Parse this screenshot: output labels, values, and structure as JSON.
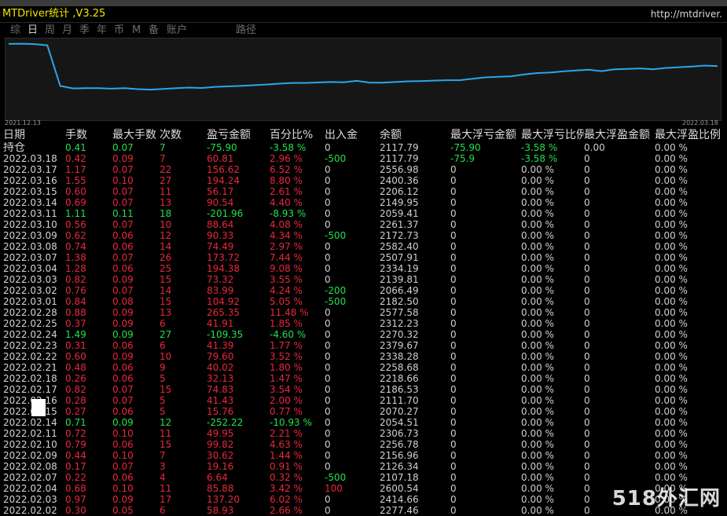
{
  "app": {
    "title": "MTDriver统计 ,V3.25",
    "url": "http://mtdriver."
  },
  "tabs": [
    {
      "label": "综",
      "active": false
    },
    {
      "label": "日",
      "active": true
    },
    {
      "label": "周",
      "active": false
    },
    {
      "label": "月",
      "active": false
    },
    {
      "label": "季",
      "active": false
    },
    {
      "label": "年",
      "active": false
    },
    {
      "label": "币",
      "active": false
    },
    {
      "label": "M",
      "active": false
    },
    {
      "label": "备",
      "active": false
    },
    {
      "label": "账户",
      "active": false
    },
    {
      "label": "路径",
      "active": false
    }
  ],
  "chart": {
    "start_date": "2021.12.13",
    "end_date": "2022.03.18",
    "line_color": "#2aa7e8",
    "y_range": [
      2000,
      3600
    ],
    "balance_series": [
      3550,
      3555,
      3548,
      3520,
      2640,
      2585,
      2590,
      2590,
      2580,
      2590,
      2570,
      2560,
      2575,
      2590,
      2605,
      2595,
      2620,
      2630,
      2640,
      2655,
      2670,
      2690,
      2705,
      2705,
      2715,
      2725,
      2720,
      2750,
      2710,
      2710,
      2725,
      2740,
      2745,
      2755,
      2765,
      2765,
      2795,
      2825,
      2838,
      2850,
      2890,
      2920,
      2930,
      2955,
      2975,
      2990,
      2960,
      3000,
      3010,
      3020,
      3000,
      3030,
      3045,
      3060,
      3080,
      3070
    ]
  },
  "columns": [
    "日期",
    "手数",
    "最大手数",
    "次数",
    "盈亏金额",
    "百分比%",
    "出入金",
    "余额",
    "最大浮亏金额",
    "最大浮亏比例",
    "最大浮盈金额",
    "最大浮盈比例"
  ],
  "position_row": {
    "date": "持仓",
    "lots": "0.41",
    "maxlots": "0.07",
    "count": "7",
    "pnl": "-75.90",
    "pct": "-3.58 %",
    "io": "0",
    "bal": "2117.79",
    "mfl": "-75.90",
    "mflp": "-3.58 %",
    "mfp": "0.00",
    "mfpp": "0.00 %",
    "color": "g"
  },
  "rows": [
    {
      "date": "2022.03.18",
      "lots": "0.42",
      "maxlots": "0.09",
      "count": "7",
      "pnl": "60.81",
      "pct": "2.96 %",
      "io": "-500",
      "bal": "2117.79",
      "mfl": "-75.9",
      "mflp": "-3.58 %",
      "mfp": "0",
      "mfpp": "0.00 %",
      "color": "r"
    },
    {
      "date": "2022.03.17",
      "lots": "1.17",
      "maxlots": "0.07",
      "count": "22",
      "pnl": "156.62",
      "pct": "6.52 %",
      "io": "0",
      "bal": "2556.98",
      "mfl": "0",
      "mflp": "0.00 %",
      "mfp": "0",
      "mfpp": "0.00 %",
      "color": "r"
    },
    {
      "date": "2022.03.16",
      "lots": "1.55",
      "maxlots": "0.10",
      "count": "27",
      "pnl": "194.24",
      "pct": "8.80 %",
      "io": "0",
      "bal": "2400.36",
      "mfl": "0",
      "mflp": "0.00 %",
      "mfp": "0",
      "mfpp": "0.00 %",
      "color": "r"
    },
    {
      "date": "2022.03.15",
      "lots": "0.60",
      "maxlots": "0.07",
      "count": "11",
      "pnl": "56.17",
      "pct": "2.61 %",
      "io": "0",
      "bal": "2206.12",
      "mfl": "0",
      "mflp": "0.00 %",
      "mfp": "0",
      "mfpp": "0.00 %",
      "color": "r"
    },
    {
      "date": "2022.03.14",
      "lots": "0.69",
      "maxlots": "0.07",
      "count": "13",
      "pnl": "90.54",
      "pct": "4.40 %",
      "io": "0",
      "bal": "2149.95",
      "mfl": "0",
      "mflp": "0.00 %",
      "mfp": "0",
      "mfpp": "0.00 %",
      "color": "r"
    },
    {
      "date": "2022.03.11",
      "lots": "1.11",
      "maxlots": "0.11",
      "count": "18",
      "pnl": "-201.96",
      "pct": "-8.93 %",
      "io": "0",
      "bal": "2059.41",
      "mfl": "0",
      "mflp": "0.00 %",
      "mfp": "0",
      "mfpp": "0.00 %",
      "color": "g"
    },
    {
      "date": "2022.03.10",
      "lots": "0.56",
      "maxlots": "0.07",
      "count": "10",
      "pnl": "88.64",
      "pct": "4.08 %",
      "io": "0",
      "bal": "2261.37",
      "mfl": "0",
      "mflp": "0.00 %",
      "mfp": "0",
      "mfpp": "0.00 %",
      "color": "r"
    },
    {
      "date": "2022.03.09",
      "lots": "0.62",
      "maxlots": "0.06",
      "count": "12",
      "pnl": "90.33",
      "pct": "4.34 %",
      "io": "-500",
      "bal": "2172.73",
      "mfl": "0",
      "mflp": "0.00 %",
      "mfp": "0",
      "mfpp": "0.00 %",
      "color": "r"
    },
    {
      "date": "2022.03.08",
      "lots": "0.74",
      "maxlots": "0.06",
      "count": "14",
      "pnl": "74.49",
      "pct": "2.97 %",
      "io": "0",
      "bal": "2582.40",
      "mfl": "0",
      "mflp": "0.00 %",
      "mfp": "0",
      "mfpp": "0.00 %",
      "color": "r"
    },
    {
      "date": "2022.03.07",
      "lots": "1.38",
      "maxlots": "0.07",
      "count": "26",
      "pnl": "173.72",
      "pct": "7.44 %",
      "io": "0",
      "bal": "2507.91",
      "mfl": "0",
      "mflp": "0.00 %",
      "mfp": "0",
      "mfpp": "0.00 %",
      "color": "r"
    },
    {
      "date": "2022.03.04",
      "lots": "1.28",
      "maxlots": "0.06",
      "count": "25",
      "pnl": "194.38",
      "pct": "9.08 %",
      "io": "0",
      "bal": "2334.19",
      "mfl": "0",
      "mflp": "0.00 %",
      "mfp": "0",
      "mfpp": "0.00 %",
      "color": "r"
    },
    {
      "date": "2022.03.03",
      "lots": "0.82",
      "maxlots": "0.09",
      "count": "15",
      "pnl": "73.32",
      "pct": "3.55 %",
      "io": "0",
      "bal": "2139.81",
      "mfl": "0",
      "mflp": "0.00 %",
      "mfp": "0",
      "mfpp": "0.00 %",
      "color": "r"
    },
    {
      "date": "2022.03.02",
      "lots": "0.76",
      "maxlots": "0.07",
      "count": "14",
      "pnl": "83.99",
      "pct": "4.24 %",
      "io": "-200",
      "bal": "2066.49",
      "mfl": "0",
      "mflp": "0.00 %",
      "mfp": "0",
      "mfpp": "0.00 %",
      "color": "r"
    },
    {
      "date": "2022.03.01",
      "lots": "0.84",
      "maxlots": "0.08",
      "count": "15",
      "pnl": "104.92",
      "pct": "5.05 %",
      "io": "-500",
      "bal": "2182.50",
      "mfl": "0",
      "mflp": "0.00 %",
      "mfp": "0",
      "mfpp": "0.00 %",
      "color": "r"
    },
    {
      "date": "2022.02.28",
      "lots": "0.88",
      "maxlots": "0.09",
      "count": "13",
      "pnl": "265.35",
      "pct": "11.48 %",
      "io": "0",
      "bal": "2577.58",
      "mfl": "0",
      "mflp": "0.00 %",
      "mfp": "0",
      "mfpp": "0.00 %",
      "color": "r"
    },
    {
      "date": "2022.02.25",
      "lots": "0.37",
      "maxlots": "0.09",
      "count": "6",
      "pnl": "41.91",
      "pct": "1.85 %",
      "io": "0",
      "bal": "2312.23",
      "mfl": "0",
      "mflp": "0.00 %",
      "mfp": "0",
      "mfpp": "0.00 %",
      "color": "r"
    },
    {
      "date": "2022.02.24",
      "lots": "1.49",
      "maxlots": "0.09",
      "count": "27",
      "pnl": "-109.35",
      "pct": "-4.60 %",
      "io": "0",
      "bal": "2270.32",
      "mfl": "0",
      "mflp": "0.00 %",
      "mfp": "0",
      "mfpp": "0.00 %",
      "color": "g"
    },
    {
      "date": "2022.02.23",
      "lots": "0.31",
      "maxlots": "0.06",
      "count": "6",
      "pnl": "41.39",
      "pct": "1.77 %",
      "io": "0",
      "bal": "2379.67",
      "mfl": "0",
      "mflp": "0.00 %",
      "mfp": "0",
      "mfpp": "0.00 %",
      "color": "r"
    },
    {
      "date": "2022.02.22",
      "lots": "0.60",
      "maxlots": "0.09",
      "count": "10",
      "pnl": "79.60",
      "pct": "3.52 %",
      "io": "0",
      "bal": "2338.28",
      "mfl": "0",
      "mflp": "0.00 %",
      "mfp": "0",
      "mfpp": "0.00 %",
      "color": "r"
    },
    {
      "date": "2022.02.21",
      "lots": "0.48",
      "maxlots": "0.06",
      "count": "9",
      "pnl": "40.02",
      "pct": "1.80 %",
      "io": "0",
      "bal": "2258.68",
      "mfl": "0",
      "mflp": "0.00 %",
      "mfp": "0",
      "mfpp": "0.00 %",
      "color": "r"
    },
    {
      "date": "2022.02.18",
      "lots": "0.26",
      "maxlots": "0.06",
      "count": "5",
      "pnl": "32.13",
      "pct": "1.47 %",
      "io": "0",
      "bal": "2218.66",
      "mfl": "0",
      "mflp": "0.00 %",
      "mfp": "0",
      "mfpp": "0.00 %",
      "color": "r"
    },
    {
      "date": "2022.02.17",
      "lots": "0.82",
      "maxlots": "0.07",
      "count": "15",
      "pnl": "74.83",
      "pct": "3.54 %",
      "io": "0",
      "bal": "2186.53",
      "mfl": "0",
      "mflp": "0.00 %",
      "mfp": "0",
      "mfpp": "0.00 %",
      "color": "r"
    },
    {
      "date": "2022.02.16",
      "lots": "0.28",
      "maxlots": "0.07",
      "count": "5",
      "pnl": "41.43",
      "pct": "2.00 %",
      "io": "0",
      "bal": "2111.70",
      "mfl": "0",
      "mflp": "0.00 %",
      "mfp": "0",
      "mfpp": "0.00 %",
      "color": "r"
    },
    {
      "date": "2022.02.15",
      "lots": "0.27",
      "maxlots": "0.06",
      "count": "5",
      "pnl": "15.76",
      "pct": "0.77 %",
      "io": "0",
      "bal": "2070.27",
      "mfl": "0",
      "mflp": "0.00 %",
      "mfp": "0",
      "mfpp": "0.00 %",
      "color": "r"
    },
    {
      "date": "2022.02.14",
      "lots": "0.71",
      "maxlots": "0.09",
      "count": "12",
      "pnl": "-252.22",
      "pct": "-10.93 %",
      "io": "0",
      "bal": "2054.51",
      "mfl": "0",
      "mflp": "0.00 %",
      "mfp": "0",
      "mfpp": "0.00 %",
      "color": "g"
    },
    {
      "date": "2022.02.11",
      "lots": "0.72",
      "maxlots": "0.10",
      "count": "11",
      "pnl": "49.95",
      "pct": "2.21 %",
      "io": "0",
      "bal": "2306.73",
      "mfl": "0",
      "mflp": "0.00 %",
      "mfp": "0",
      "mfpp": "0.00 %",
      "color": "r"
    },
    {
      "date": "2022.02.10",
      "lots": "0.79",
      "maxlots": "0.06",
      "count": "15",
      "pnl": "99.82",
      "pct": "4.63 %",
      "io": "0",
      "bal": "2256.78",
      "mfl": "0",
      "mflp": "0.00 %",
      "mfp": "0",
      "mfpp": "0.00 %",
      "color": "r"
    },
    {
      "date": "2022.02.09",
      "lots": "0.44",
      "maxlots": "0.10",
      "count": "7",
      "pnl": "30.62",
      "pct": "1.44 %",
      "io": "0",
      "bal": "2156.96",
      "mfl": "0",
      "mflp": "0.00 %",
      "mfp": "0",
      "mfpp": "0.00 %",
      "color": "r"
    },
    {
      "date": "2022.02.08",
      "lots": "0.17",
      "maxlots": "0.07",
      "count": "3",
      "pnl": "19.16",
      "pct": "0.91 %",
      "io": "0",
      "bal": "2126.34",
      "mfl": "0",
      "mflp": "0.00 %",
      "mfp": "0",
      "mfpp": "0.00 %",
      "color": "r"
    },
    {
      "date": "2022.02.07",
      "lots": "0.22",
      "maxlots": "0.06",
      "count": "4",
      "pnl": "6.64",
      "pct": "0.32 %",
      "io": "-500",
      "bal": "2107.18",
      "mfl": "0",
      "mflp": "0.00 %",
      "mfp": "0",
      "mfpp": "0.00 %",
      "color": "r"
    },
    {
      "date": "2022.02.04",
      "lots": "0.68",
      "maxlots": "0.10",
      "count": "11",
      "pnl": "85.88",
      "pct": "3.42 %",
      "io": "100",
      "bal": "2600.54",
      "mfl": "0",
      "mflp": "0.00 %",
      "mfp": "0",
      "mfpp": "0.00 %",
      "color": "r"
    },
    {
      "date": "2022.02.03",
      "lots": "0.97",
      "maxlots": "0.09",
      "count": "17",
      "pnl": "137.20",
      "pct": "6.02 %",
      "io": "0",
      "bal": "2414.66",
      "mfl": "0",
      "mflp": "0.00 %",
      "mfp": "0",
      "mfpp": "0.00 %",
      "color": "r"
    },
    {
      "date": "2022.02.02",
      "lots": "0.30",
      "maxlots": "0.05",
      "count": "6",
      "pnl": "58.93",
      "pct": "2.66 %",
      "io": "0",
      "bal": "2277.46",
      "mfl": "0",
      "mflp": "0.00 %",
      "mfp": "0",
      "mfpp": "0.00 %",
      "color": "r"
    }
  ],
  "watermark": "518外汇网"
}
